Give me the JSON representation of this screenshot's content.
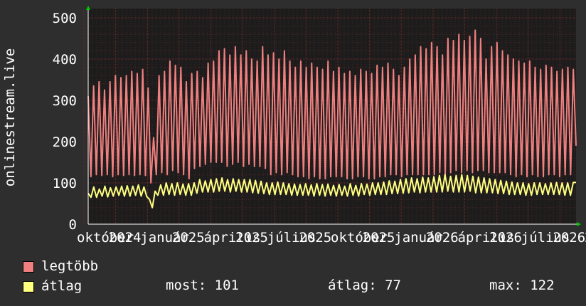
{
  "chart_data": {
    "type": "line",
    "ylabel": "onlinestream.live",
    "ylim": [
      0,
      500
    ],
    "yticks": [
      0,
      100,
      200,
      300,
      400,
      500
    ],
    "xticks": [
      "október",
      "2024",
      "január",
      "2025",
      "április",
      "2025",
      "július",
      "2025",
      "október",
      "2025",
      "január",
      "2026",
      "április",
      "2026",
      "július",
      "2026",
      "20"
    ],
    "grid": true,
    "legend_placement": "bottom-left",
    "colors": {
      "background": "#2e2e2e",
      "plot_bg": "#1c1c1c",
      "grid": "#6e2a2a",
      "axis": "#ffffff",
      "arrow": "#00cc00"
    },
    "series": [
      {
        "name": "legtöbb",
        "color": "#f08080",
        "values": [
          310,
          115,
          335,
          120,
          345,
          118,
          325,
          120,
          345,
          115,
          360,
          120,
          355,
          118,
          360,
          120,
          370,
          118,
          365,
          120,
          375,
          118,
          330,
          100,
          210,
          120,
          360,
          125,
          370,
          120,
          395,
          130,
          385,
          125,
          380,
          120,
          345,
          110,
          365,
          135,
          370,
          140,
          355,
          145,
          390,
          150,
          395,
          150,
          420,
          150,
          425,
          140,
          410,
          145,
          430,
          150,
          410,
          140,
          420,
          145,
          400,
          140,
          395,
          140,
          430,
          135,
          410,
          120,
          415,
          125,
          400,
          120,
          420,
          125,
          395,
          120,
          380,
          115,
          395,
          115,
          380,
          110,
          390,
          115,
          380,
          110,
          375,
          110,
          395,
          115,
          370,
          115,
          380,
          115,
          365,
          110,
          370,
          110,
          360,
          115,
          375,
          115,
          370,
          110,
          365,
          110,
          385,
          115,
          380,
          115,
          390,
          120,
          375,
          120,
          360,
          115,
          380,
          120,
          400,
          120,
          410,
          120,
          430,
          120,
          425,
          120,
          440,
          120,
          430,
          125,
          410,
          120,
          450,
          125,
          445,
          130,
          460,
          125,
          445,
          130,
          455,
          125,
          470,
          130,
          450,
          130,
          400,
          125,
          430,
          125,
          440,
          125,
          420,
          125,
          410,
          120,
          400,
          115,
          395,
          120,
          390,
          115,
          395,
          120,
          380,
          115,
          375,
          115,
          385,
          120,
          380,
          120,
          370,
          115,
          375,
          120,
          380,
          120,
          375,
          190
        ]
      },
      {
        "name": "átlag",
        "color": "#ffff80",
        "values": [
          75,
          65,
          90,
          65,
          85,
          68,
          92,
          66,
          88,
          68,
          90,
          70,
          92,
          68,
          93,
          68,
          92,
          70,
          95,
          68,
          90,
          67,
          60,
          40,
          80,
          70,
          95,
          70,
          100,
          72,
          98,
          70,
          100,
          72,
          97,
          70,
          98,
          70,
          100,
          75,
          108,
          78,
          105,
          78,
          108,
          78,
          110,
          80,
          112,
          80,
          108,
          78,
          110,
          80,
          108,
          78,
          108,
          78,
          108,
          76,
          106,
          75,
          104,
          74,
          100,
          72,
          100,
          72,
          102,
          72,
          100,
          72,
          98,
          70,
          97,
          70,
          96,
          70,
          98,
          70,
          95,
          68,
          98,
          70,
          96,
          68,
          97,
          70,
          94,
          68,
          96,
          70,
          92,
          68,
          98,
          70,
          94,
          68,
          98,
          72,
          97,
          70,
          100,
          72,
          100,
          72,
          102,
          72,
          105,
          74,
          104,
          74,
          108,
          75,
          110,
          76,
          112,
          78,
          110,
          76,
          114,
          78,
          112,
          78,
          115,
          78,
          118,
          78,
          120,
          80,
          116,
          78,
          118,
          78,
          120,
          78,
          118,
          80,
          116,
          76,
          114,
          76,
          112,
          76,
          110,
          76,
          108,
          74,
          106,
          74,
          104,
          72,
          102,
          72,
          100,
          72,
          100,
          70,
          98,
          70,
          100,
          72,
          100,
          72,
          98,
          72,
          100,
          72,
          101,
          72,
          100,
          70,
          100,
          70,
          101,
          101
        ]
      }
    ]
  },
  "legend": [
    {
      "label": "legtöbb",
      "color": "#f08080"
    },
    {
      "label": "átlag",
      "color": "#ffff80"
    }
  ],
  "stats": {
    "most": "most: 101",
    "atlag": "átlag: 77",
    "max": "max: 122"
  }
}
